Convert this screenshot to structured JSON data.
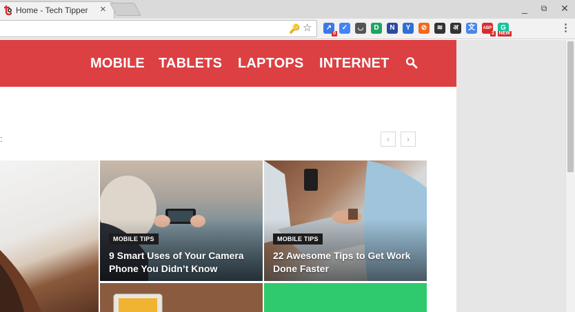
{
  "browser": {
    "tab_title": "Home - Tech Tipper",
    "tab_close": "×",
    "window_controls": {
      "minimize": "_",
      "restore": "⧉",
      "close": "✕"
    },
    "omnibox_icons": {
      "key": "🔑",
      "star": "☆"
    },
    "extensions": [
      {
        "name": "graph-extension-icon",
        "glyph": "↗",
        "color": "#3b78e7",
        "badge": "0"
      },
      {
        "name": "check-extension-icon",
        "glyph": "✓",
        "color": "#4285f4",
        "badge": ""
      },
      {
        "name": "pocket-extension-icon",
        "glyph": "◡",
        "color": "#555555",
        "badge": ""
      },
      {
        "name": "d-extension-icon",
        "glyph": "D",
        "color": "#1fa463",
        "badge": ""
      },
      {
        "name": "n-extension-icon",
        "glyph": "N",
        "color": "#2b4aa0",
        "badge": ""
      },
      {
        "name": "y-extension-icon",
        "glyph": "Y",
        "color": "#2f6fd6",
        "badge": ""
      },
      {
        "name": "block-extension-icon",
        "glyph": "⊘",
        "color": "#f06a1b",
        "badge": ""
      },
      {
        "name": "buffer-extension-icon",
        "glyph": "≋",
        "color": "#333333",
        "badge": ""
      },
      {
        "name": "hindi-extension-icon",
        "glyph": "अ",
        "color": "#333333",
        "badge": ""
      },
      {
        "name": "translate-extension-icon",
        "glyph": "文",
        "color": "#4a86e8",
        "badge": ""
      },
      {
        "name": "adblock-extension-icon",
        "glyph": "ABP",
        "color": "#d32f2f",
        "badge": "2"
      },
      {
        "name": "grammarly-extension-icon",
        "glyph": "G",
        "color": "#15c39a",
        "badge": "NEW"
      }
    ],
    "menu": "⋮"
  },
  "site": {
    "brand_color": "#dc4043",
    "nav": [
      "MOBILE",
      "TABLETS",
      "LAPTOPS",
      "INTERNET"
    ],
    "pager": {
      "prev": "‹",
      "next": "›"
    },
    "cards": [
      {
        "label": "MOBILE TIPS",
        "title": "9 Smart Uses of Your Camera Phone You Didn’t Know"
      },
      {
        "label": "MOBILE TIPS",
        "title": "22 Awesome Tips to Get Work Done Faster"
      }
    ]
  }
}
